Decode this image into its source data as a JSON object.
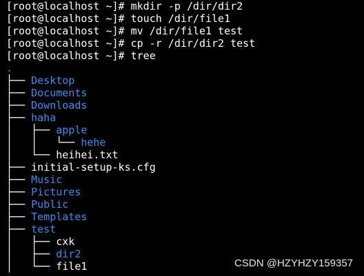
{
  "terminal": {
    "commands": [
      "[root@localhost ~]# mkdir -p /dir/dir2",
      "[root@localhost ~]# touch /dir/file1",
      "[root@localhost ~]# mv /dir/file1 test",
      "[root@localhost ~]# cp -r /dir/dir2 test",
      "[root@localhost ~]# tree"
    ],
    "tree_root": ".",
    "tree": [
      {
        "prefix": "├── ",
        "name": "Desktop",
        "kind": "dir"
      },
      {
        "prefix": "├── ",
        "name": "Documents",
        "kind": "dir"
      },
      {
        "prefix": "├── ",
        "name": "Downloads",
        "kind": "dir"
      },
      {
        "prefix": "├── ",
        "name": "haha",
        "kind": "dir"
      },
      {
        "prefix": "│   ├── ",
        "name": "apple",
        "kind": "dir"
      },
      {
        "prefix": "│   │   └── ",
        "name": "hehe",
        "kind": "dir"
      },
      {
        "prefix": "│   └── ",
        "name": "heihei.txt",
        "kind": "file"
      },
      {
        "prefix": "├── ",
        "name": "initial-setup-ks.cfg",
        "kind": "file"
      },
      {
        "prefix": "├── ",
        "name": "Music",
        "kind": "dir"
      },
      {
        "prefix": "├── ",
        "name": "Pictures",
        "kind": "dir"
      },
      {
        "prefix": "├── ",
        "name": "Public",
        "kind": "dir"
      },
      {
        "prefix": "├── ",
        "name": "Templates",
        "kind": "dir"
      },
      {
        "prefix": "├── ",
        "name": "test",
        "kind": "dir"
      },
      {
        "prefix": "│   ├── ",
        "name": "cxk",
        "kind": "file"
      },
      {
        "prefix": "│   ├── ",
        "name": "dir2",
        "kind": "dir"
      },
      {
        "prefix": "│   └── ",
        "name": "file1",
        "kind": "file"
      }
    ],
    "colors": {
      "background": "#000000",
      "text": "#ffffff",
      "directory": "#3b8eea"
    }
  },
  "watermark": "CSDN @HZYHZY159357"
}
